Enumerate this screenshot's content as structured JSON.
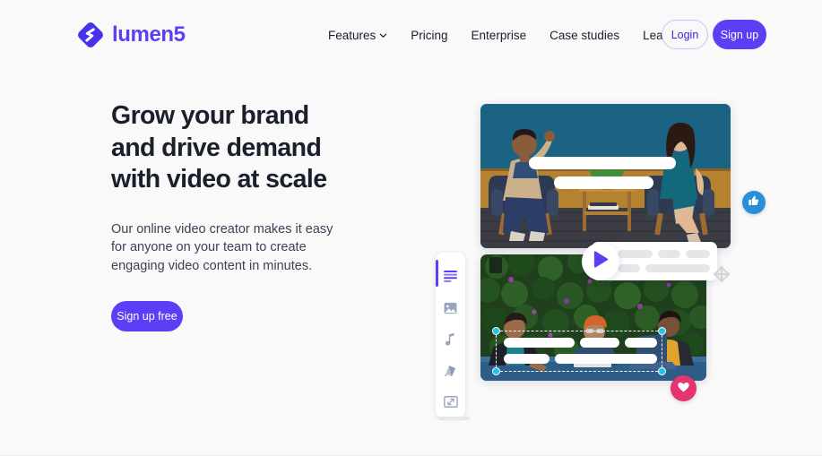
{
  "brand": {
    "name": "lumen5",
    "logo_icon": "lumen5-logo-icon",
    "accent_color": "#5b3ff5"
  },
  "header": {
    "nav": [
      {
        "label": "Features",
        "has_caret": true,
        "icon": "chevron-down-icon"
      },
      {
        "label": "Pricing",
        "has_caret": false,
        "icon": ""
      },
      {
        "label": "Enterprise",
        "has_caret": false,
        "icon": ""
      },
      {
        "label": "Case studies",
        "has_caret": false,
        "icon": ""
      },
      {
        "label": "Learn",
        "has_caret": true,
        "icon": "chevron-down-icon"
      }
    ],
    "login_label": "Login",
    "signup_label": "Sign up"
  },
  "hero": {
    "title_line1": "Grow your brand",
    "title_line2": "and drive demand",
    "title_line3": "with video at scale",
    "subtitle": "Our online video creator makes it easy for anyone on your team to create engaging video content in minutes.",
    "cta_label": "Sign up free"
  },
  "editor": {
    "sidebar": [
      {
        "name": "text-tool",
        "icon": "text-lines-icon",
        "active": true
      },
      {
        "name": "media-tool",
        "icon": "image-icon",
        "active": false
      },
      {
        "name": "audio-tool",
        "icon": "music-note-icon",
        "active": false
      },
      {
        "name": "brand-tool",
        "icon": "palette-icon",
        "active": false
      },
      {
        "name": "layout-tool",
        "icon": "resize-frame-icon",
        "active": false
      }
    ],
    "play_button_icon": "play-icon",
    "move_cursor_icon": "move-cursor-icon",
    "selection_handle_color": "#1fc4e8",
    "reactions": [
      {
        "name": "like",
        "icon": "thumbs-up-icon",
        "color": "#2b8fd8"
      },
      {
        "name": "love",
        "icon": "heart-icon",
        "color": "#e5346f"
      }
    ],
    "video_one": {
      "scene": "two-people-seated-interview",
      "wall_color": "#1c5f7d"
    },
    "video_two": {
      "scene": "three-people-at-table-foliage",
      "wall_color": "#22401f"
    }
  }
}
